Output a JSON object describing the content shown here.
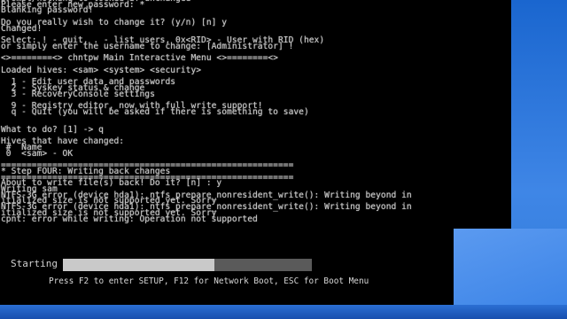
{
  "console": {
    "lines": [
      "prompt/nothing to locked if unchanged",
      "Please enter new password: *",
      "Blanking password!",
      "",
      "Do you really wish to change it? (y/n) [n] y",
      "Changed!",
      "",
      "Select: ! - quit, . - list users, 0x<RID> - User with RID (hex)",
      "or simply enter the username to change: [Administrator] !",
      "",
      "<>========<> chntpw Main Interactive Menu <>========<>",
      "",
      "Loaded hives: <sam> <system> <security>",
      "",
      "  1 - Edit user data and passwords",
      "  2 - Syskey status & change",
      "  3 - RecoveryConsole settings",
      "",
      "  9 - Registry editor, now with full write support!",
      "  q - Quit (you will be asked if there is something to save)",
      "",
      "",
      "What to do? [1] -> q",
      "",
      "Hives that have changed:",
      " #  Name",
      " 0  <sam> - OK",
      "",
      "=========================================================",
      "* Step FOUR: Writing back changes",
      "=========================================================",
      "About to write file(s) back! Do it? [n] : y",
      "Writing sam",
      "NTFS-3G error (device hda1): ntfs_prepare_nonresident_write(): Writing beyond in",
      "itialized size is not supported yet. Sorry",
      "NTFS-3G error (device hda1): ntfs_prepare_nonresident_write(): Writing beyond in",
      "itialized size is not supported yet. Sorry",
      "cpnt: error while writing: Operation not supported"
    ]
  },
  "boot": {
    "starting_label": "Starting",
    "progress": 0.61,
    "hint": "Press F2 to enter SETUP, F12 for Network Boot, ESC for Boot Menu"
  }
}
